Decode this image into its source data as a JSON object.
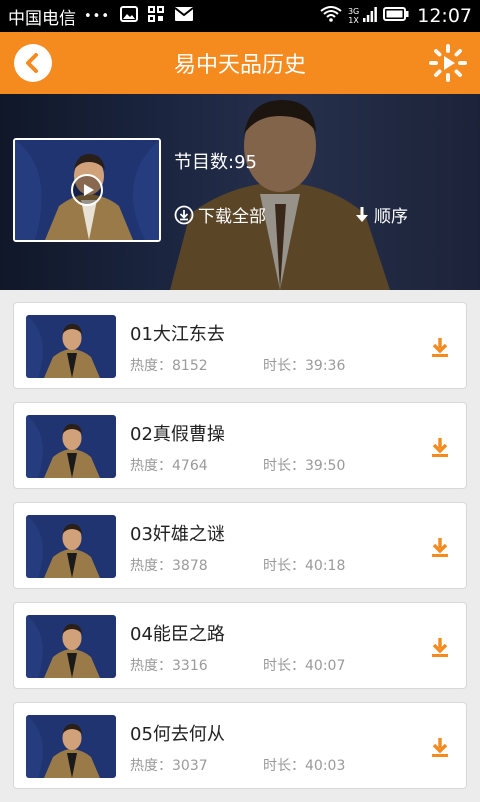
{
  "status_bar": {
    "carrier": "中国电信",
    "dots": "•••",
    "net_top": "3G",
    "net_bottom": "1X",
    "time": "12:07"
  },
  "header": {
    "title": "易中天品历史"
  },
  "hero": {
    "count_label": "节目数:95",
    "download_all": "下载全部",
    "order": "顺序"
  },
  "colors": {
    "accent": "#f58a1f",
    "text_muted": "#9a9a9a"
  },
  "episodes": [
    {
      "title": "01大江东去",
      "heat": "热度：8152",
      "duration": "时长：39:36"
    },
    {
      "title": "02真假曹操",
      "heat": "热度：4764",
      "duration": "时长：39:50"
    },
    {
      "title": "03奸雄之谜",
      "heat": "热度：3878",
      "duration": "时长：40:18"
    },
    {
      "title": "04能臣之路",
      "heat": "热度：3316",
      "duration": "时长：40:07"
    },
    {
      "title": "05何去何从",
      "heat": "热度：3037",
      "duration": "时长：40:03"
    }
  ]
}
